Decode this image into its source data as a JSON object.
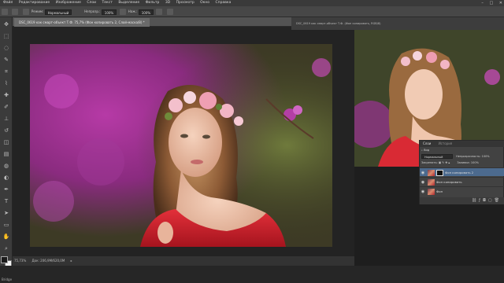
{
  "menubar": {
    "items": [
      "Файл",
      "Редактирование",
      "Изображение",
      "Слои",
      "Текст",
      "Выделение",
      "Фильтр",
      "3D",
      "Просмотр",
      "Окно",
      "Справка"
    ],
    "window_controls": [
      "–",
      "□",
      "✕"
    ]
  },
  "options_bar": {
    "mode_label": "Режим:",
    "mode_value": "Нормальный",
    "opacity_label": "Непрозр.:",
    "opacity_value": "100%",
    "flow_label": "Наж.:",
    "flow_value": "100%"
  },
  "document": {
    "tab_title": "DSC_0619 как смарт-объект Т.Ф. 75,7% (Фон копировать 2, Слой-маска/8) *",
    "zoom": "75,73%",
    "doc_size": "Док: 206,9М/620,0М"
  },
  "preview": {
    "title": "DSC_0619 как смарт-объект Т.Ф. (Фон копировать, RGB/8)"
  },
  "layers_panel": {
    "tabs": [
      "Слои",
      "История"
    ],
    "kind_label": "Вид",
    "blend_mode": "Нормальный",
    "opacity_label": "Непрозрачность:",
    "opacity_value": "100%",
    "lock_label": "Закрепить:",
    "fill_label": "Заливка:",
    "fill_value": "100%",
    "layers": [
      {
        "name": "Фон копировать 2",
        "active": true,
        "has_mask": true
      },
      {
        "name": "Фон копировать",
        "active": false,
        "has_mask": false
      },
      {
        "name": "Фон",
        "active": false,
        "has_mask": false
      }
    ]
  },
  "bottom": {
    "bridge_label": "Bridge"
  },
  "colors": {
    "accent_layer": "#4c6a8e",
    "ui_dark": "#232323",
    "dress_red": "#d0202a"
  }
}
